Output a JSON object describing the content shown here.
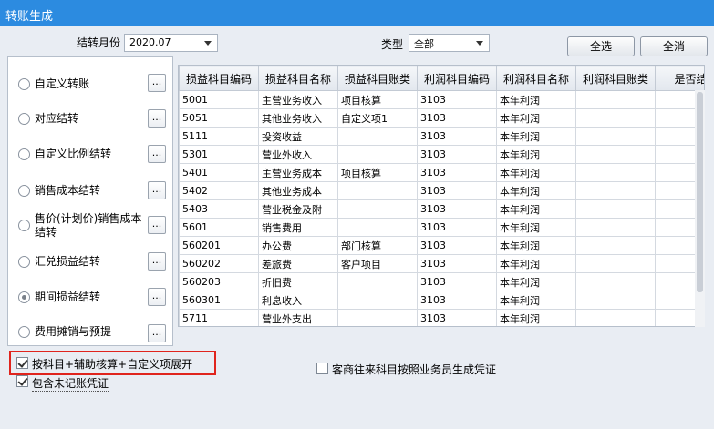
{
  "window": {
    "title": "转账生成"
  },
  "filters": {
    "month_label": "结转月份",
    "month_value": "2020.07",
    "type_label": "类型",
    "type_value": "全部",
    "select_all": "全选",
    "deselect_all": "全消"
  },
  "options": [
    {
      "label": "自定义转账",
      "selected": false
    },
    {
      "label": "对应结转",
      "selected": false
    },
    {
      "label": "自定义比例结转",
      "selected": false
    },
    {
      "label": "销售成本结转",
      "selected": false
    },
    {
      "label": "售价(计划价)销售成本结转",
      "selected": false
    },
    {
      "label": "汇兑损益结转",
      "selected": false
    },
    {
      "label": "期间损益结转",
      "selected": true
    },
    {
      "label": "费用摊销与预提",
      "selected": false
    }
  ],
  "dots_label": "...",
  "table": {
    "columns": [
      "损益科目编码",
      "损益科目名称",
      "损益科目账类",
      "利润科目编码",
      "利润科目名称",
      "利润科目账类",
      "是否结"
    ],
    "rows": [
      [
        "5001",
        "主营业务收入",
        "项目核算",
        "3103",
        "本年利润",
        "",
        ""
      ],
      [
        "5051",
        "其他业务收入",
        "自定义项1",
        "3103",
        "本年利润",
        "",
        ""
      ],
      [
        "5111",
        "投资收益",
        "",
        "3103",
        "本年利润",
        "",
        ""
      ],
      [
        "5301",
        "营业外收入",
        "",
        "3103",
        "本年利润",
        "",
        ""
      ],
      [
        "5401",
        "主营业务成本",
        "项目核算",
        "3103",
        "本年利润",
        "",
        ""
      ],
      [
        "5402",
        "其他业务成本",
        "",
        "3103",
        "本年利润",
        "",
        ""
      ],
      [
        "5403",
        "营业税金及附",
        "",
        "3103",
        "本年利润",
        "",
        ""
      ],
      [
        "5601",
        "销售费用",
        "",
        "3103",
        "本年利润",
        "",
        ""
      ],
      [
        "560201",
        "办公费",
        "部门核算",
        "3103",
        "本年利润",
        "",
        ""
      ],
      [
        "560202",
        "差旅费",
        "客户项目",
        "3103",
        "本年利润",
        "",
        ""
      ],
      [
        "560203",
        "折旧费",
        "",
        "3103",
        "本年利润",
        "",
        ""
      ],
      [
        "560301",
        "利息收入",
        "",
        "3103",
        "本年利润",
        "",
        ""
      ],
      [
        "5711",
        "营业外支出",
        "",
        "3103",
        "本年利润",
        "",
        ""
      ]
    ]
  },
  "checkboxes": {
    "expand": {
      "label": "按科目+辅助核算+自定义项展开",
      "checked": true
    },
    "include_unposted": {
      "label": "包含未记账凭证",
      "checked": true
    },
    "by_salesperson": {
      "label": "客商往来科目按照业务员生成凭证",
      "checked": false
    }
  }
}
